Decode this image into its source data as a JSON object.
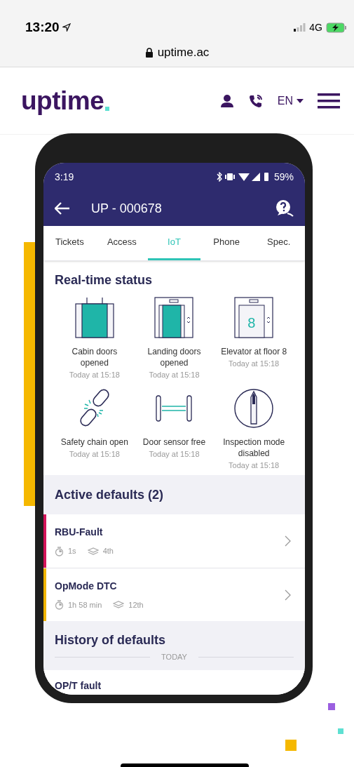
{
  "ios_status": {
    "time": "13:20",
    "network": "4G"
  },
  "address_bar": {
    "url": "uptime.ac"
  },
  "site_header": {
    "logo": "uptime",
    "language": "EN"
  },
  "app": {
    "status_bar": {
      "time": "3:19",
      "battery": "59%"
    },
    "title": "UP - 000678",
    "tabs": [
      {
        "label": "Tickets",
        "selected": false
      },
      {
        "label": "Access",
        "selected": false
      },
      {
        "label": "IoT",
        "selected": true
      },
      {
        "label": "Phone",
        "selected": false
      },
      {
        "label": "Spec.",
        "selected": false
      }
    ],
    "realtime": {
      "title": "Real-time status",
      "items": [
        {
          "kind": "cabin_doors",
          "label": "Cabin doors opened",
          "time": "Today at 15:18"
        },
        {
          "kind": "landing_doors",
          "label": "Landing doors opened",
          "time": "Today at 15:18"
        },
        {
          "kind": "floor",
          "display": "8",
          "label": "Elevator at floor 8",
          "time": "Today at 15:18"
        },
        {
          "kind": "chain",
          "label": "Safety chain open",
          "time": "Today at 15:18"
        },
        {
          "kind": "sensor",
          "label": "Door sensor free",
          "time": "Today at 15:18"
        },
        {
          "kind": "inspection",
          "label": "Inspection mode disabled",
          "time": "Today at 15:18"
        }
      ]
    },
    "active_defaults": {
      "title": "Active defaults (2)",
      "items": [
        {
          "name": "RBU-Fault",
          "duration": "1s",
          "floor": "4th",
          "color": "#d4145a"
        },
        {
          "name": "OpMode DTC",
          "duration": "1h 58 min",
          "floor": "12th",
          "color": "#f0b400"
        }
      ]
    },
    "history": {
      "title": "History of defaults",
      "day": "TODAY",
      "items": [
        {
          "name": "OP/T fault"
        }
      ]
    }
  }
}
